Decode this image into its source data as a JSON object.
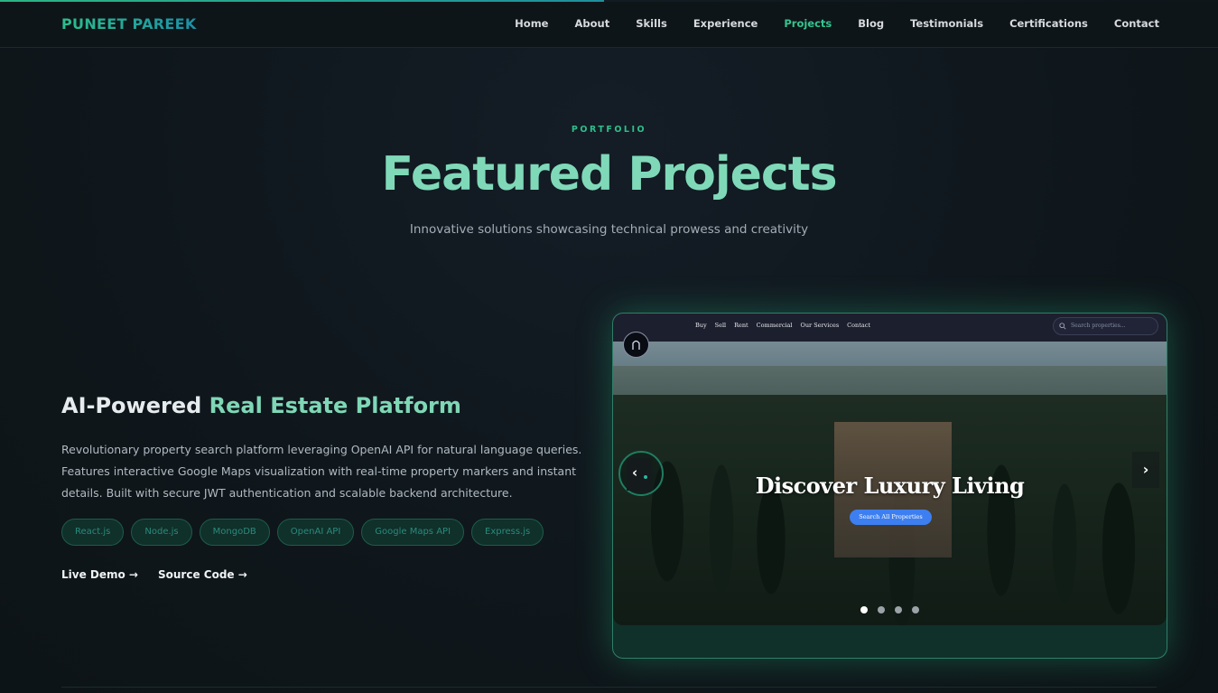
{
  "header": {
    "logo": "PUNEET PAREEK",
    "nav": [
      "Home",
      "About",
      "Skills",
      "Experience",
      "Projects",
      "Blog",
      "Testimonials",
      "Certifications",
      "Contact"
    ],
    "active": "Projects"
  },
  "section": {
    "eyebrow": "PORTFOLIO",
    "title": "Featured Projects",
    "subtitle": "Innovative solutions showcasing technical prowess and creativity"
  },
  "project": {
    "title_part1": "AI-Powered",
    "title_part2": "Real Estate Platform",
    "description": "Revolutionary property search platform leveraging OpenAI API for natural language queries. Features interactive Google Maps visualization with real-time property markers and instant details. Built with secure JWT authentication and scalable backend architecture.",
    "tags": [
      "React.js",
      "Node.js",
      "MongoDB",
      "OpenAI API",
      "Google Maps API",
      "Express.js"
    ],
    "live_demo": "Live Demo →",
    "source_code": "Source Code →"
  },
  "preview": {
    "nav": [
      "Buy",
      "Sell",
      "Rent",
      "Commercial",
      "Our Services",
      "Contact"
    ],
    "search_placeholder": "Search properties...",
    "hero": "Discover Luxury Living",
    "button": "Search All Properties",
    "prev": "‹",
    "next": "›",
    "slide_count": 4,
    "active_slide": 1
  },
  "colors": {
    "accent": "#34c48f",
    "title": "#7fd9b8",
    "button": "#3d7ff0"
  }
}
